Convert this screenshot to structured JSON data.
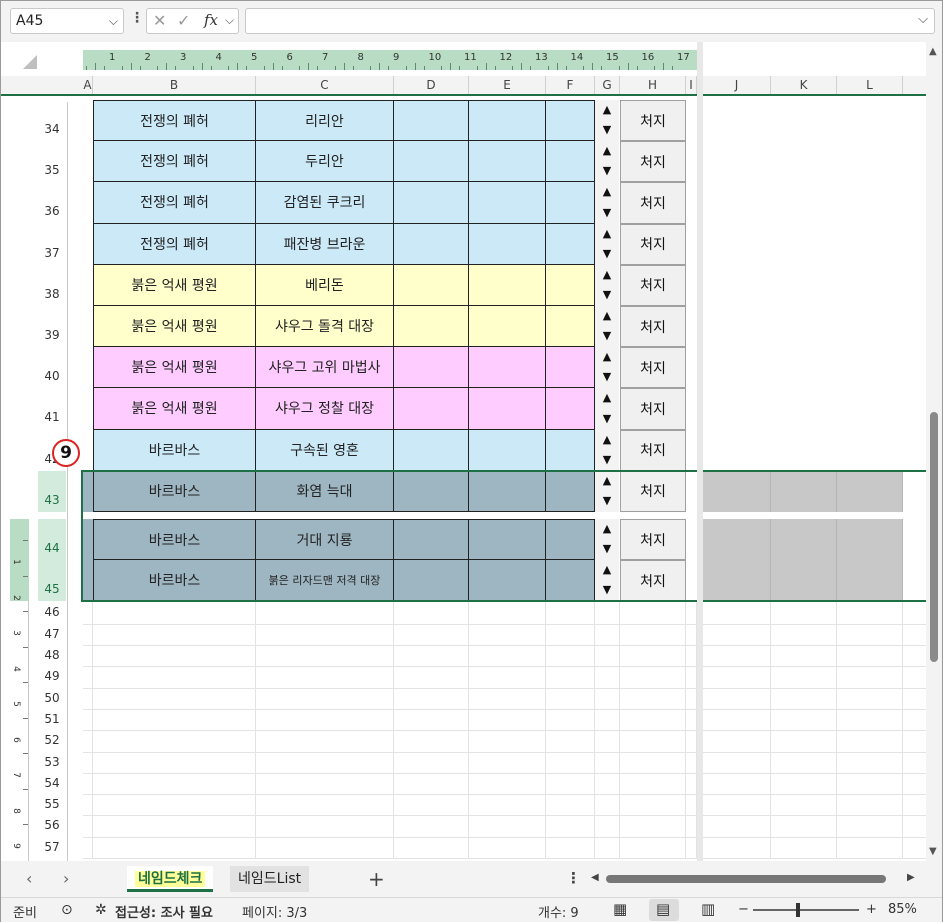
{
  "formula_bar": {
    "name_box": "A45",
    "cancel_icon": "✕",
    "enter_icon": "✓",
    "fx_label": "fx",
    "formula": ""
  },
  "ruler": {
    "numbers": [
      "1",
      "2",
      "3",
      "4",
      "5",
      "6",
      "7",
      "8",
      "9",
      "10",
      "11",
      "12",
      "13",
      "14",
      "15",
      "16",
      "17"
    ],
    "vertical_numbers": [
      "1",
      "2",
      "3",
      "4",
      "5",
      "6",
      "7",
      "8",
      "9"
    ]
  },
  "columns": [
    "A",
    "B",
    "C",
    "D",
    "E",
    "F",
    "G",
    "H",
    "I",
    "J",
    "K",
    "L"
  ],
  "rows": [
    {
      "num": "34",
      "b": "전쟁의 폐허",
      "c": "리리안",
      "action": "처지"
    },
    {
      "num": "35",
      "b": "전쟁의 폐허",
      "c": "두리안",
      "action": "처지"
    },
    {
      "num": "36",
      "b": "전쟁의 폐허",
      "c": "감염된 쿠크리",
      "action": "처지"
    },
    {
      "num": "37",
      "b": "전쟁의 폐허",
      "c": "패잔병 브라운",
      "action": "처지"
    },
    {
      "num": "38",
      "b": "붉은 억새 평원",
      "c": "베리돈",
      "action": "처지"
    },
    {
      "num": "39",
      "b": "붉은 억새 평원",
      "c": "샤우그 돌격 대장",
      "action": "처지"
    },
    {
      "num": "40",
      "b": "붉은 억새 평원",
      "c": "샤우그 고위 마법사",
      "action": "처지"
    },
    {
      "num": "41",
      "b": "붉은 억새 평원",
      "c": "샤우그 정찰 대장",
      "action": "처지"
    },
    {
      "num": "42",
      "b": "바르바스",
      "c": "구속된 영혼",
      "action": "처지"
    },
    {
      "num": "43",
      "b": "바르바스",
      "c": "화염 늑대",
      "action": "처지"
    },
    {
      "num": "44",
      "b": "바르바스",
      "c": "거대 지룡",
      "action": "처지"
    },
    {
      "num": "45",
      "b": "바르바스",
      "c": "붉은 리자드맨 저격 대장",
      "action": "처지"
    }
  ],
  "empty_rows": [
    "46",
    "47",
    "48",
    "49",
    "50",
    "51",
    "52",
    "53",
    "54",
    "55",
    "56",
    "57"
  ],
  "marker": "9",
  "colors": {
    "light_blue": "#cce9f8",
    "light_yellow": "#ffffcc",
    "light_pink": "#ffccff",
    "selected_slate": "#9eb6c1",
    "excel_green": "#1e7145"
  },
  "tabs": {
    "active": "네임드체크",
    "second": "네임드List",
    "add": "+"
  },
  "status": {
    "ready": "준비",
    "accessibility": "접근성: 조사 필요",
    "page": "페이지: 3/3",
    "count": "개수: 9",
    "zoom": "85%",
    "zoom_minus": "−",
    "zoom_plus": "+"
  },
  "icons": {
    "name_box_dropdown": "chevron-down-icon",
    "formula_dropdown": "chevron-down-icon",
    "sheet_prev": "chevron-left-icon",
    "sheet_next": "chevron-right-icon",
    "macro_record": "macro-record-icon",
    "accessibility": "accessibility-icon",
    "view_normal": "grid-view-icon",
    "view_page_layout": "page-layout-icon",
    "view_page_break": "page-break-icon"
  }
}
